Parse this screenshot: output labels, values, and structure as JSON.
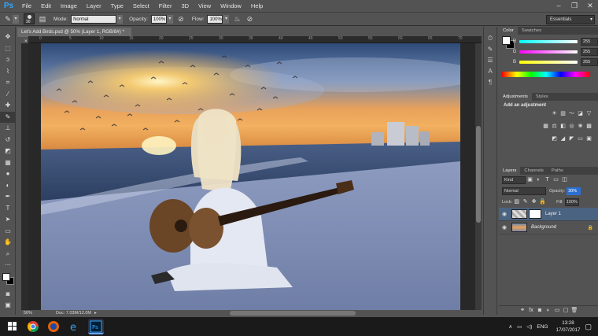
{
  "app": {
    "logo": "Ps"
  },
  "menu": [
    "File",
    "Edit",
    "Image",
    "Layer",
    "Type",
    "Select",
    "Filter",
    "3D",
    "View",
    "Window",
    "Help"
  ],
  "window_controls": [
    "–",
    "❐",
    "✕"
  ],
  "options": {
    "brush_size": "30",
    "mode_label": "Mode:",
    "mode_value": "Normal",
    "opacity_label": "Opacity:",
    "opacity_value": "100%",
    "flow_label": "Flow:",
    "flow_value": "100%",
    "workspace": "Essentials"
  },
  "document": {
    "tab_title": "Let's Add Birds.psd @ 50% (Layer 1, RGB/8#) *",
    "close_glyph": "×",
    "ruler_ticks": [
      "0",
      "5",
      "10",
      "15",
      "20",
      "25",
      "30",
      "35",
      "40",
      "45",
      "50",
      "55",
      "60",
      "65",
      "70"
    ],
    "zoom": "50%",
    "doc_size": "Doc: 7.03M/12.0M"
  },
  "tools": [
    "move-icon",
    "marquee-icon",
    "lasso-icon",
    "quick-select-icon",
    "crop-icon",
    "eyedropper-icon",
    "healing-icon",
    "brush-icon",
    "stamp-icon",
    "history-brush-icon",
    "eraser-icon",
    "gradient-icon",
    "blur-icon",
    "dodge-icon",
    "pen-icon",
    "type-icon",
    "path-select-icon",
    "shape-icon",
    "hand-icon",
    "zoom-icon"
  ],
  "color_panel": {
    "tabs": [
      "Color",
      "Swatches"
    ],
    "channels": [
      {
        "label": "R",
        "value": "255",
        "gradient": "#00ffff"
      },
      {
        "label": "G",
        "value": "255",
        "gradient": "#ff00ff"
      },
      {
        "label": "B",
        "value": "255",
        "gradient": "#ffff00"
      }
    ]
  },
  "adjustments_panel": {
    "tabs": [
      "Adjustments",
      "Styles"
    ],
    "title": "Add an adjustment"
  },
  "layers_panel": {
    "tabs": [
      "Layers",
      "Channels",
      "Paths"
    ],
    "kind_label": "Kind",
    "blend_mode": "Normal",
    "opacity_label": "Opacity:",
    "opacity_value": "30%",
    "lock_label": "Lock:",
    "fill_label": "Fill:",
    "fill_value": "100%",
    "layers": [
      {
        "name": "Layer 1",
        "selected": true
      },
      {
        "name": "Background",
        "selected": false
      }
    ]
  },
  "taskbar": {
    "language": "ENG",
    "time": "13:28",
    "date": "17/07/2017"
  },
  "colors": {
    "accent": "#31a8ff",
    "ui_bg": "#535353",
    "dark": "#282828"
  }
}
